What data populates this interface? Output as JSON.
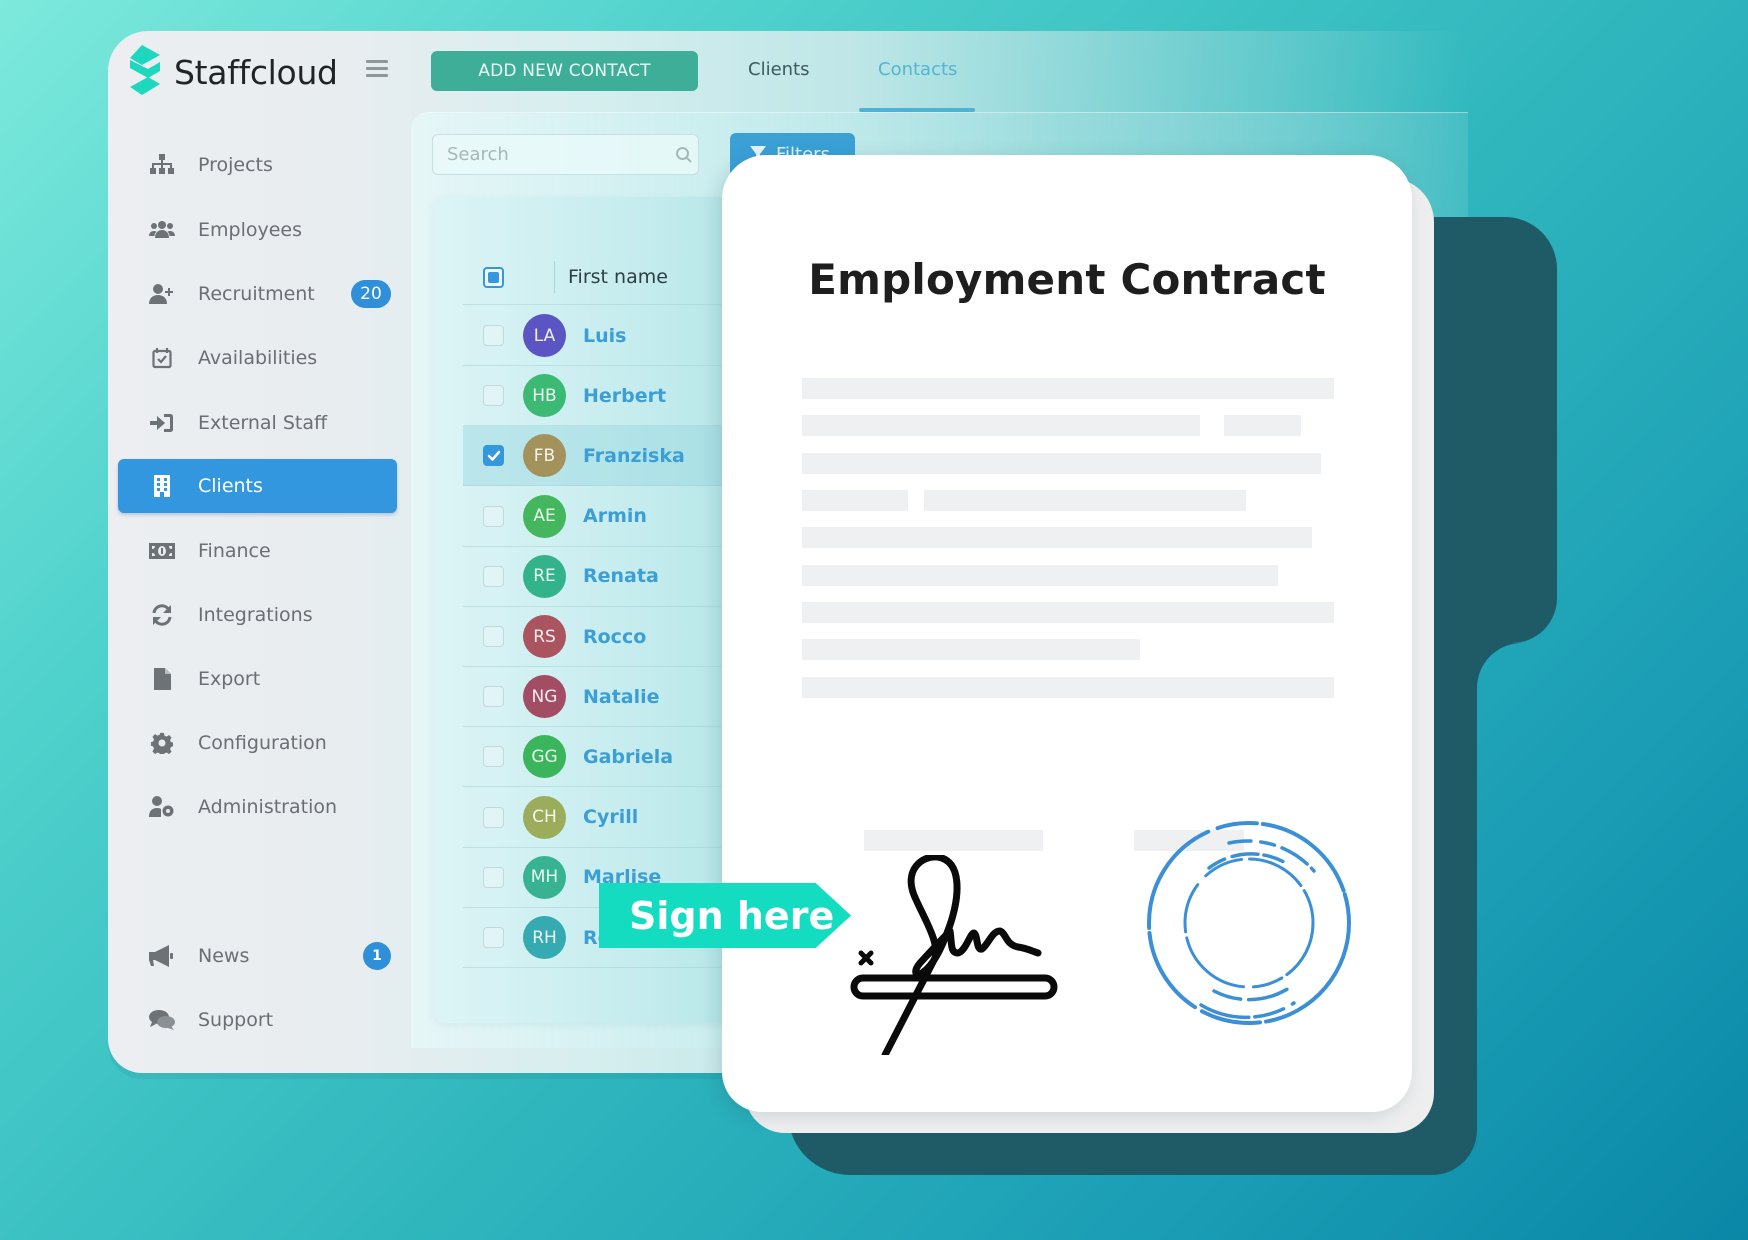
{
  "app": {
    "brand": "Staffcloud",
    "brand_color": "#1ed8be",
    "accent_color": "#3397e0"
  },
  "toolbar": {
    "add_button_label": "ADD NEW CONTACT",
    "tabs": [
      {
        "label": "Clients",
        "active": false
      },
      {
        "label": "Contacts",
        "active": true
      }
    ]
  },
  "sidebar": {
    "items": [
      {
        "label": "Projects",
        "icon": "sitemap-icon"
      },
      {
        "label": "Employees",
        "icon": "users-icon"
      },
      {
        "label": "Recruitment",
        "icon": "user-plus-icon",
        "badge": "20"
      },
      {
        "label": "Availabilities",
        "icon": "calendar-check-icon"
      },
      {
        "label": "External Staff",
        "icon": "sign-in-icon"
      },
      {
        "label": "Clients",
        "icon": "building-icon",
        "active": true
      },
      {
        "label": "Finance",
        "icon": "money-bill-icon"
      },
      {
        "label": "Integrations",
        "icon": "sync-icon"
      },
      {
        "label": "Export",
        "icon": "file-icon"
      },
      {
        "label": "Configuration",
        "icon": "gear-icon"
      },
      {
        "label": "Administration",
        "icon": "user-cog-icon"
      }
    ],
    "bottom_items": [
      {
        "label": "News",
        "icon": "megaphone-icon",
        "badge": "1"
      },
      {
        "label": "Support",
        "icon": "comments-icon"
      }
    ]
  },
  "search": {
    "placeholder": "Search",
    "value": ""
  },
  "filters_label": "Filters",
  "table": {
    "column_header": "First name",
    "header_checkbox": "partial",
    "rows": [
      {
        "initials": "LA",
        "name": "Luis",
        "color": "#5b55c4",
        "checked": false
      },
      {
        "initials": "HB",
        "name": "Herbert",
        "color": "#3cba73",
        "checked": false
      },
      {
        "initials": "FB",
        "name": "Franziska",
        "color": "#a3925a",
        "checked": true
      },
      {
        "initials": "AE",
        "name": "Armin",
        "color": "#43b65e",
        "checked": false
      },
      {
        "initials": "RE",
        "name": "Renata",
        "color": "#33b38a",
        "checked": false
      },
      {
        "initials": "RS",
        "name": "Rocco",
        "color": "#a9545f",
        "checked": false
      },
      {
        "initials": "NG",
        "name": "Natalie",
        "color": "#a24d63",
        "checked": false
      },
      {
        "initials": "GG",
        "name": "Gabriela",
        "color": "#3ab55c",
        "checked": false
      },
      {
        "initials": "CH",
        "name": "Cyrill",
        "color": "#9bad5b",
        "checked": false
      },
      {
        "initials": "MH",
        "name": "Marlise",
        "color": "#37b391",
        "checked": false
      },
      {
        "initials": "RH",
        "name": "Ro",
        "color": "#35aab0",
        "checked": false
      }
    ]
  },
  "document": {
    "title": "Employment Contract",
    "sign_label": "Sign here",
    "stamp_color": "#3a8fd6",
    "signature_color": "#0a0a0a"
  }
}
